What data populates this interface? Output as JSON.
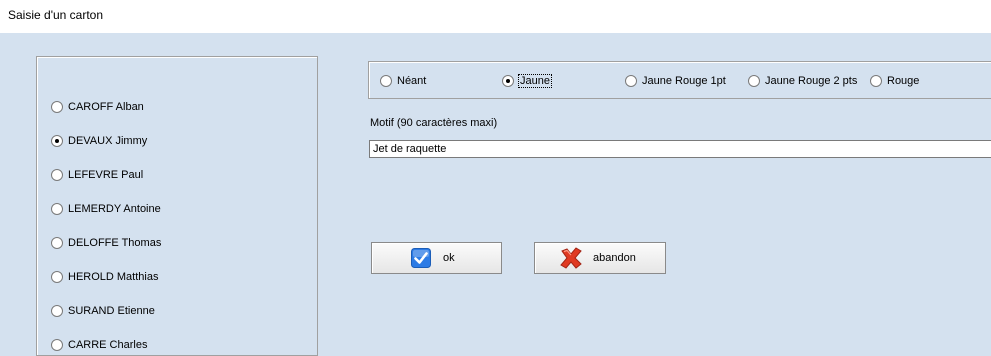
{
  "window": {
    "title": "Saisie d'un carton"
  },
  "players": [
    {
      "label": "CAROFF  Alban",
      "checked": false
    },
    {
      "label": "DEVAUX  Jimmy",
      "checked": true
    },
    {
      "label": "LEFEVRE  Paul",
      "checked": false
    },
    {
      "label": "LEMERDY  Antoine",
      "checked": false
    },
    {
      "label": "DELOFFE  Thomas",
      "checked": false
    },
    {
      "label": "HEROLD  Matthias",
      "checked": false
    },
    {
      "label": "SURAND  Etienne",
      "checked": false
    },
    {
      "label": "CARRE  Charles",
      "checked": false
    }
  ],
  "card_types": [
    {
      "label": "Néant",
      "checked": false
    },
    {
      "label": "Jaune",
      "checked": true
    },
    {
      "label": "Jaune Rouge 1pt",
      "checked": false
    },
    {
      "label": "Jaune Rouge 2 pts",
      "checked": false
    },
    {
      "label": "Rouge",
      "checked": false
    }
  ],
  "motif": {
    "label": "Motif (90 caractères maxi)",
    "value": "Jet de raquette"
  },
  "buttons": {
    "ok_label": "ok",
    "ok_icon": "checkmark-icon",
    "cancel_label": "abandon",
    "cancel_icon": "red-x-icon"
  },
  "colors": {
    "background": "#d4e1ef",
    "ok_icon_blue": "#2c7be5",
    "cancel_icon_red": "#e03a22"
  }
}
